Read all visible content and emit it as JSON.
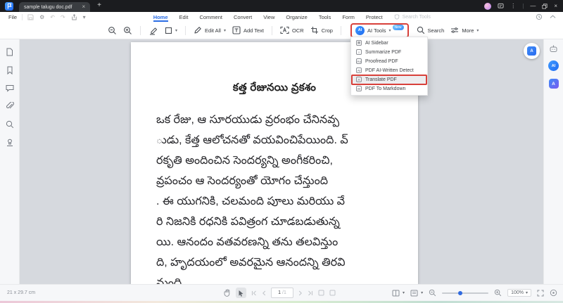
{
  "titlebar": {
    "tab_title": "sample talugu doc.pdf"
  },
  "icons": {
    "chevron_down": "▾",
    "kebab": "⋮",
    "minimize": "—",
    "close": "×",
    "plus": "+",
    "divider": "|",
    "undo": "↶",
    "redo": "↷",
    "gear": "⚙",
    "ai": "AI",
    "summarize_glyph": "≡",
    "proofread_glyph": "Aa",
    "ai_detect_glyph": "AI",
    "translate_glyph": "A",
    "markdown_glyph": "M",
    "sidebar_glyph": "▤"
  },
  "menubar": {
    "file": "File",
    "tabs": [
      {
        "label": "Home"
      },
      {
        "label": "Edit"
      },
      {
        "label": "Comment"
      },
      {
        "label": "Convert"
      },
      {
        "label": "View"
      },
      {
        "label": "Organize"
      },
      {
        "label": "Tools"
      },
      {
        "label": "Form"
      },
      {
        "label": "Protect"
      }
    ],
    "active_tab": "Home",
    "search_tools": "Search Tools"
  },
  "toolbar": {
    "edit_all": "Edit All",
    "add_text": "Add Text",
    "ocr": "OCR",
    "crop": "Crop",
    "ai_tools": "AI Tools",
    "ai_badge": "New",
    "search": "Search",
    "more": "More"
  },
  "ai_menu": {
    "items": [
      {
        "label": "AI Sidebar"
      },
      {
        "label": "Summarize PDF"
      },
      {
        "label": "Proofread PDF"
      },
      {
        "label": "PDF AI-Written Detect"
      },
      {
        "label": "Translate PDF"
      },
      {
        "label": "PDF To Markdown"
      }
    ],
    "highlighted": "Translate PDF"
  },
  "document": {
    "heading": "కత్త రేజునయి వ్రకశం",
    "lines": [
      "ఒక రేజు, ఆ సూరయుడు వ్రరంభం చేనినవ్ప",
      "ుడు, కేత్త ఆలోచనతో వయవించిపేయింది. వ్",
      "రకృతి అందించిన సెందర్యన్ని అంగీకరించి,",
      "వ్రపంచం ఆ సెందర్యంతో యోగం చేన్తుంది",
      ". ఈ యుగనికి, చలమంది పూలు మరియు వే",
      "రి నిజనికి రధనికి పవిత్రంగ చూడబడుతున్న",
      "యి. ఆనందం వతవరణన్ని తను తలవిన్తుం",
      "ది, హృదయంలో అవరమైన ఆనందన్ని తిరవి",
      "న్తుంది."
    ]
  },
  "statusbar": {
    "page_size": "21 x 29.7 cm",
    "page_current": "1",
    "page_total": "/1",
    "zoom_level": "100%"
  },
  "colors": {
    "accent_blue": "#2b6de4",
    "highlight_red": "#d8403a",
    "ai_blue": "#2e80f7",
    "canvas_gray": "#d6d9de"
  }
}
